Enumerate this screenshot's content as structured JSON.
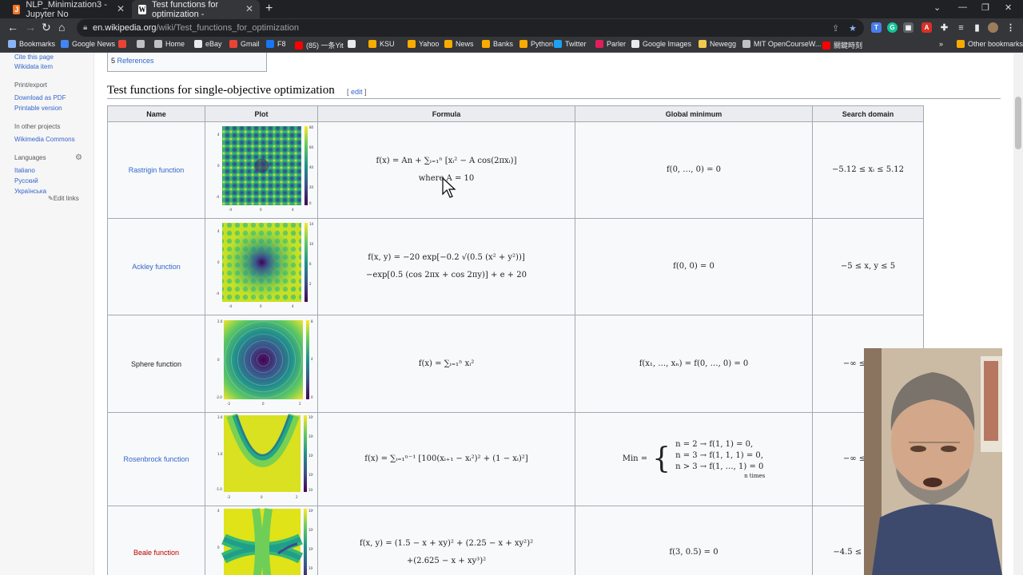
{
  "browser": {
    "tabs": [
      {
        "label": "NLP_Minimization3 - Jupyter No",
        "icon": "jupyter-icon",
        "active": false
      },
      {
        "label": "Test functions for optimization -",
        "icon": "wikipedia-icon",
        "active": true
      }
    ],
    "url_domain": "en.wikipedia.org",
    "url_path": "/wiki/Test_functions_for_optimization",
    "bookmarks": [
      "Bookmarks",
      "Google News",
      "",
      "",
      "Home",
      "eBay",
      "Gmail",
      "F8",
      "(85) 一条Yit",
      "",
      "KSU",
      "Yahoo",
      "News",
      "Banks",
      "Python",
      "Twitter",
      "Parler",
      "Google Images",
      "Newegg",
      "MIT OpenCourseW...",
      "關鍵時刻"
    ],
    "other_bookmarks": "Other bookmarks",
    "chevron": "»"
  },
  "sidebar": {
    "tools_links": [
      "Cite this page",
      "Wikidata item"
    ],
    "print_heading": "Print/export",
    "print_links": [
      "Download as PDF",
      "Printable version"
    ],
    "projects_heading": "In other projects",
    "projects_links": [
      "Wikimedia Commons"
    ],
    "languages_heading": "Languages",
    "language_links": [
      "Italiano",
      "Русский",
      "Українська"
    ],
    "edit_links": "Edit links"
  },
  "toc": {
    "number": "5",
    "label": "References"
  },
  "section": {
    "title": "Test functions for single-objective optimization",
    "edit": "edit"
  },
  "table": {
    "headers": [
      "Name",
      "Plot",
      "Formula",
      "Global minimum",
      "Search domain"
    ],
    "rows": [
      {
        "name": "Rastrigin function",
        "formula_line1": "f(x) = An + ∑ᵢ₌₁ⁿ [xᵢ² − A cos(2πxᵢ)]",
        "formula_line2": "where A = 10",
        "minimum": "f(0, …, 0) = 0",
        "domain": "−5.12 ≤ xᵢ ≤ 5.12",
        "plot": "rastrigin"
      },
      {
        "name": "Ackley function",
        "formula_line1": "f(x, y) = −20 exp[−0.2 √(0.5 (x² + y²))]",
        "formula_line2": "−exp[0.5 (cos 2πx + cos 2πy)] + e + 20",
        "minimum": "f(0, 0) = 0",
        "domain": "−5 ≤ x, y ≤ 5",
        "plot": "ackley"
      },
      {
        "name": "Sphere function",
        "formula_line1": "f(x) = ∑ᵢ₌₁ⁿ xᵢ²",
        "formula_line2": "",
        "minimum": "f(x₁, …, xₙ) = f(0, …, 0) = 0",
        "domain": "−∞ ≤ xᵢ ≤ ∞",
        "plot": "sphere"
      },
      {
        "name": "Rosenbrock function",
        "formula_line1": "f(x) = ∑ᵢ₌₁ⁿ⁻¹ [100(xᵢ₊₁ − xᵢ²)² + (1 − xᵢ)²]",
        "formula_line2": "",
        "minimum_lines": [
          "n = 2 → f(1, 1) = 0,",
          "n = 3 → f(1, 1, 1) = 0,",
          "n > 3 → f(1, …, 1) = 0"
        ],
        "minimum_prefix": "Min =",
        "minimum_note": "n times",
        "domain": "−∞ ≤ xᵢ ≤ ∞",
        "plot": "rosenbrock"
      },
      {
        "name": "Beale function",
        "formula_line1": "f(x, y) = (1.5 − x + xy)² + (2.25 − x + xy²)²",
        "formula_line2": "+(2.625 − x + xy³)²",
        "minimum": "f(3, 0.5) = 0",
        "domain": "−4.5 ≤ x, y ≤ 4.5",
        "plot": "beale",
        "link_red": true
      }
    ]
  },
  "colors": {
    "link": "#3366cc",
    "redlink": "#ba0000",
    "header_bg": "#eaecf0",
    "border": "#a2a9b1"
  }
}
